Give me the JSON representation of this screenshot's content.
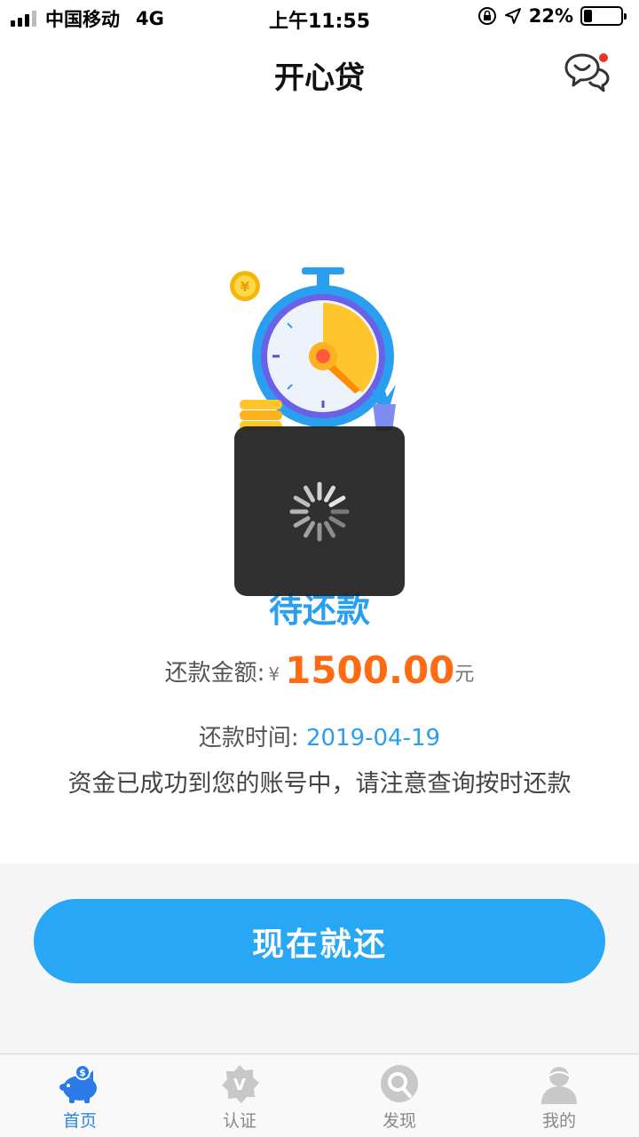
{
  "status_bar": {
    "carrier": "中国移动",
    "network": "4G",
    "time": "上午11:55",
    "battery_percent_text": "22%",
    "battery_level": 0.22
  },
  "nav": {
    "title": "开心贷",
    "chat_icon": "chat-bubble-icon"
  },
  "main": {
    "status_label": "待还款",
    "amount_label": "还款金额:",
    "currency_symbol": "¥",
    "amount_value": "1500.00",
    "amount_unit": "元",
    "date_label": "还款时间:",
    "date_value": "2019-04-19",
    "note": "资金已成功到您的账号中，请注意查询按时还款",
    "repay_button": "现在就还"
  },
  "tabs": [
    {
      "label": "首页",
      "icon": "piggy-bank-icon",
      "active": true
    },
    {
      "label": "认证",
      "icon": "verify-badge-icon",
      "active": false
    },
    {
      "label": "发现",
      "icon": "discover-icon",
      "active": false
    },
    {
      "label": "我的",
      "icon": "user-icon",
      "active": false
    }
  ],
  "colors": {
    "accent": "#28a7f5",
    "amount": "#ff6a13",
    "tab_active": "#2a86e0"
  }
}
